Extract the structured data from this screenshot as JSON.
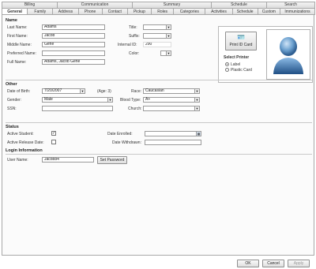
{
  "tabs_top": [
    "Billing",
    "Communication",
    "Summary",
    "Schedule",
    "Search"
  ],
  "tabs_bottom": [
    "General",
    "Family",
    "Address",
    "Phone",
    "Contact",
    "Pickup",
    "Roles",
    "Categories",
    "Activities",
    "Schedule",
    "Custom",
    "Immunizations"
  ],
  "name": {
    "section": "Name",
    "last_label": "Last Name:",
    "last_value": "Adams",
    "first_label": "First Name:",
    "first_value": "Jacob",
    "middle_label": "Middle Name:",
    "middle_value": "Gene",
    "preferred_label": "Preferred Name:",
    "preferred_value": "",
    "full_label": "Full Name:",
    "full_value": "Adams, Jacob Gene",
    "title_label": "Title:",
    "title_value": "",
    "suffix_label": "Suffix:",
    "suffix_value": "",
    "ids_label": "Internal ID:",
    "ids_value": "290",
    "color_label": "Color:"
  },
  "photo": {
    "print_label": "Print ID Card",
    "select_printer_label": "Select Printer",
    "printer_option_1": "Label",
    "printer_option_2": "Plastic Card",
    "avatar_icon": "user-silhouette-icon"
  },
  "other": {
    "section": "Other",
    "dob_label": "Date of Birth:",
    "dob_value": "7/20/2007",
    "age_label": "(Age: 3)",
    "gender_label": "Gender:",
    "gender_value": "Male",
    "ssn_label": "SSN:",
    "ssn_value": "",
    "race_label": "Race:",
    "race_value": "Caucasian",
    "blood_label": "Blood Type:",
    "blood_value": "A+",
    "church_label": "Church:",
    "church_value": ""
  },
  "status": {
    "section": "Status",
    "active_label": "Active Student:",
    "active_checked": "✓",
    "auto_label": "Active Release Date:",
    "date_enrolled_label": "Date Enrolled:",
    "date_left_label": "Date Withdrawn:"
  },
  "login": {
    "section": "Login Information",
    "user_label": "User Name:",
    "user_value": "Jacob84",
    "reset_label": "Set Password"
  },
  "footer": {
    "ok_label": "OK",
    "cancel_label": "Cancel",
    "apply_label": "Apply"
  }
}
